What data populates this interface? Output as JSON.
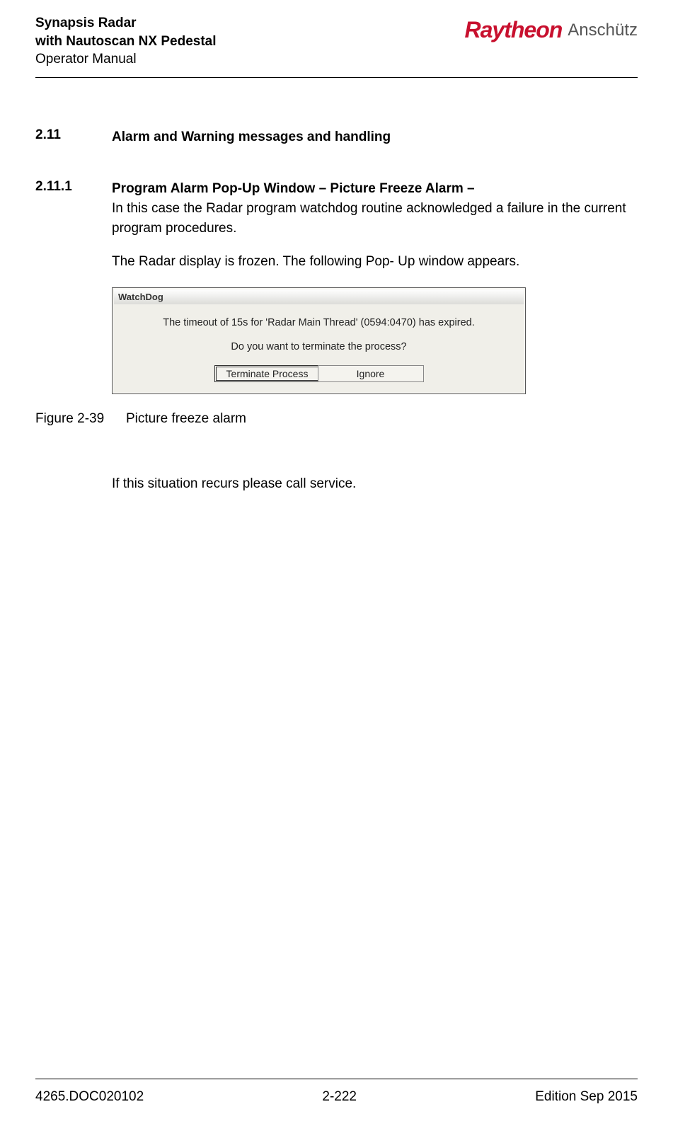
{
  "header": {
    "title_line1": "Synapsis Radar",
    "title_line2": "with Nautoscan NX Pedestal",
    "title_line3": "Operator Manual",
    "logo_raytheon": "Raytheon",
    "logo_anschutz": "Anschütz"
  },
  "sections": {
    "s1_num": "2.11",
    "s1_title": "Alarm and Warning messages and handling",
    "s2_num": "2.11.1",
    "s2_title": "Program Alarm Pop-Up Window – Picture Freeze Alarm –",
    "s2_p1": "In this case the Radar program watchdog routine acknowledged a failure in the current program procedures.",
    "s2_p2": "The Radar display is frozen. The following Pop- Up window appears."
  },
  "dialog": {
    "title": "WatchDog",
    "line1": "The timeout of 15s for 'Radar Main Thread' (0594:0470) has expired.",
    "line2": "Do you want to terminate the process?",
    "btn_terminate": "Terminate Process",
    "btn_ignore": "Ignore"
  },
  "figure": {
    "number": "Figure 2-39",
    "caption": "Picture freeze alarm"
  },
  "after": {
    "p1": "If this situation recurs please call service."
  },
  "footer": {
    "left": "4265.DOC020102",
    "center": "2-222",
    "right": "Edition Sep 2015"
  }
}
